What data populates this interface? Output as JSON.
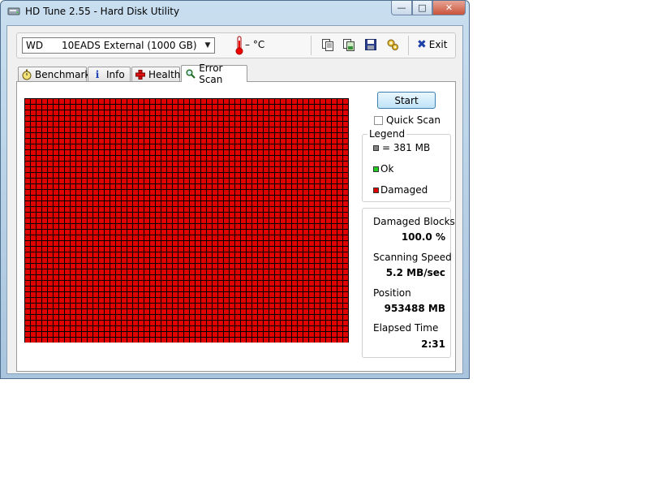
{
  "window": {
    "title": "HD Tune 2.55 - Hard Disk Utility"
  },
  "toolbar": {
    "drive": "WD      10EADS External (1000 GB)",
    "temperature": "– °C",
    "exit_label": "Exit"
  },
  "tabs": [
    {
      "label": "Benchmark"
    },
    {
      "label": "Info"
    },
    {
      "label": "Health"
    },
    {
      "label": "Error Scan"
    }
  ],
  "error_scan": {
    "start_label": "Start",
    "quick_scan_label": "Quick Scan",
    "quick_scan_checked": false,
    "legend": {
      "title": "Legend",
      "block_size": "= 381 MB",
      "ok": "Ok",
      "damaged": "Damaged"
    },
    "stats": {
      "damaged_blocks_label": "Damaged Blocks",
      "damaged_blocks_value": "100.0 %",
      "scanning_speed_label": "Scanning Speed",
      "scanning_speed_value": "5.2 MB/sec",
      "position_label": "Position",
      "position_value": "953488 MB",
      "elapsed_label": "Elapsed Time",
      "elapsed_value": "2:31"
    },
    "grid_block_state": "damaged"
  },
  "colors": {
    "damaged": "#e00000",
    "ok": "#22cc22",
    "block_size": "#808080",
    "grid_line": "#000000"
  }
}
